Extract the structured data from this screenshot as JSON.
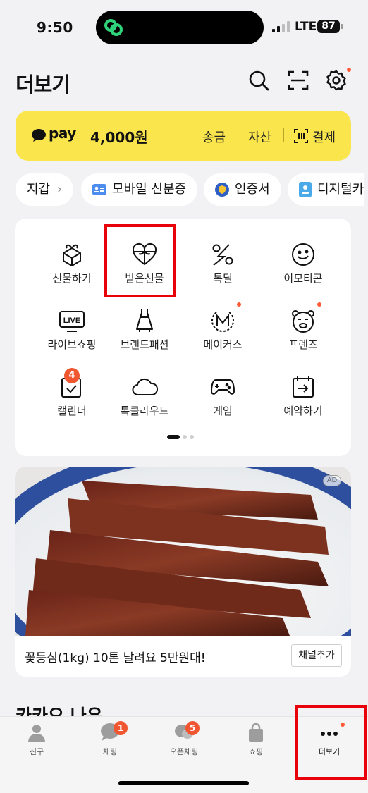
{
  "status": {
    "time": "9:50",
    "network": "LTE",
    "battery": "87"
  },
  "header": {
    "title": "더보기",
    "icons": [
      "search-icon",
      "scan-icon",
      "settings-icon"
    ]
  },
  "pay": {
    "brand": "pay",
    "amount": "4,000원",
    "actions": [
      "송금",
      "자산",
      "결제"
    ]
  },
  "chips": [
    "지갑",
    "모바일 신분증",
    "인증서",
    "디지털카"
  ],
  "grid": {
    "items": [
      {
        "label": "선물하기",
        "icon": "gift-box-icon"
      },
      {
        "label": "받은선물",
        "icon": "heart-gift-icon"
      },
      {
        "label": "톡딜",
        "icon": "percent-icon"
      },
      {
        "label": "이모티콘",
        "icon": "smiley-icon"
      },
      {
        "label": "라이브쇼핑",
        "icon": "live-tv-icon"
      },
      {
        "label": "브랜드패션",
        "icon": "dress-icon"
      },
      {
        "label": "메이커스",
        "icon": "makers-icon"
      },
      {
        "label": "프렌즈",
        "icon": "friends-bear-icon"
      },
      {
        "label": "캘린더",
        "icon": "calendar-icon",
        "badge": "4"
      },
      {
        "label": "톡클라우드",
        "icon": "cloud-icon"
      },
      {
        "label": "게임",
        "icon": "gamepad-icon"
      },
      {
        "label": "예약하기",
        "icon": "reservation-icon"
      }
    ]
  },
  "ad": {
    "badge": "AD",
    "text": "꽃등심(1kg) 10톤 날려요 5만원대!",
    "button": "채널추가"
  },
  "section_title": "카카오 나우",
  "tabbar": {
    "tabs": [
      {
        "label": "친구",
        "icon": "person-icon"
      },
      {
        "label": "채팅",
        "icon": "chat-bubble-icon",
        "badge": "1"
      },
      {
        "label": "오픈채팅",
        "icon": "open-chat-icon",
        "badge": "5"
      },
      {
        "label": "쇼핑",
        "icon": "shopping-bag-icon"
      },
      {
        "label": "더보기",
        "icon": "more-dots-icon"
      }
    ]
  },
  "colors": {
    "pay_yellow": "#fae64c",
    "highlight": "#e8000b",
    "badge": "#f0562f"
  }
}
